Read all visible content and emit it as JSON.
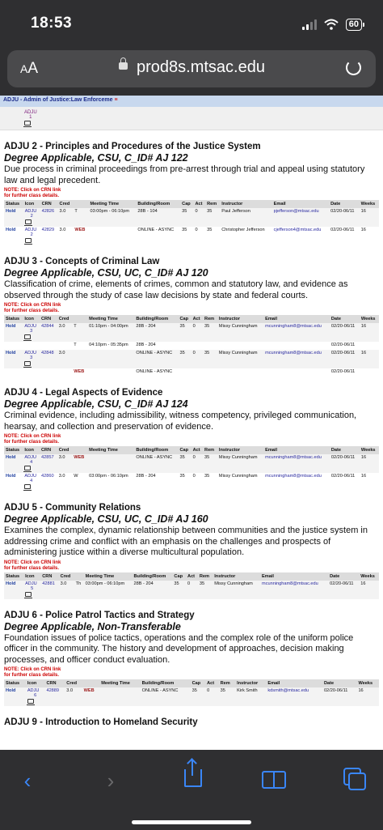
{
  "status": {
    "time": "18:53",
    "battery": "60"
  },
  "browser": {
    "aa_small": "A",
    "aa_big": "A",
    "url": "prod8s.mtsac.edu"
  },
  "subject_bar": {
    "label": "ADJU - Admin of Justice:Law Enforceme",
    "menu_icon": "≡"
  },
  "top_fragment": {
    "icon_code": "ADJU",
    "icon_num": "1"
  },
  "columns": [
    "Status",
    "Icon",
    "CRN",
    "Cred",
    "",
    "Meeting Time",
    "Building/Room",
    "Cap",
    "Act",
    "Rem",
    "Instructor",
    "Email",
    "Date",
    "Weeks"
  ],
  "note": {
    "line1": "NOTE: Click on CRN link",
    "line2": "for further class details."
  },
  "courses": [
    {
      "title": "ADJU 2 - Principles and Procedures of the Justice System",
      "sub": "Degree Applicable, CSU, C_ID# AJ 122",
      "desc": "Due process in criminal proceedings from pre-arrest through trial and appeal using statutory law and legal precedent.",
      "rows": [
        {
          "status": "Hold",
          "code": "ADJU",
          "num": "2",
          "crn": "42826",
          "cred": "3.0",
          "day": "T",
          "time": "03:00pm - 06:10pm",
          "room": "28B - 104",
          "cap": "35",
          "act": "0",
          "rem": "35",
          "instructor": "Paul Jefferson",
          "email": "pjefferson@mtsac.edu",
          "date": "02/20-06/11",
          "weeks": "16"
        },
        {
          "status": "Hold",
          "code": "ADJU",
          "num": "2",
          "crn": "42829",
          "cred": "3.0",
          "day": "WEB",
          "time": "",
          "room": "ONLINE - ASYNC",
          "cap": "35",
          "act": "0",
          "rem": "35",
          "instructor": "Christopher Jefferson",
          "email": "cjefferson4@mtsac.edu",
          "date": "02/20-06/11",
          "weeks": "16"
        }
      ]
    },
    {
      "title": "ADJU 3 - Concepts of Criminal Law",
      "sub": "Degree Applicable, CSU, UC, C_ID# AJ 120",
      "desc": "Classification of crime, elements of crimes, common and statutory law, and evidence as observed through the study of case law decisions by state and federal courts.",
      "rows": [
        {
          "status": "Hold",
          "code": "ADJU",
          "num": "3",
          "crn": "42844",
          "cred": "3.0",
          "day": "T",
          "time": "01:10pm - 04:00pm",
          "room": "28B - 204",
          "cap": "35",
          "act": "0",
          "rem": "35",
          "instructor": "Missy Cunningham",
          "email": "mcunningham8@mtsac.edu",
          "date": "02/20-06/11",
          "weeks": "16"
        },
        {
          "status": "",
          "code": "",
          "num": "",
          "crn": "",
          "cred": "",
          "day": "T",
          "time": "04:10pm - 05:35pm",
          "room": "28B - 204",
          "cap": "",
          "act": "",
          "rem": "",
          "instructor": "",
          "email": "",
          "date": "02/20-06/11",
          "weeks": "",
          "sub": true
        },
        {
          "status": "Hold",
          "code": "ADJU",
          "num": "3",
          "crn": "42848",
          "cred": "3.0",
          "day": "",
          "time": "",
          "room": "ONLINE - ASYNC",
          "cap": "35",
          "act": "0",
          "rem": "35",
          "instructor": "Missy Cunningham",
          "email": "mcunningham8@mtsac.edu",
          "date": "02/20-06/11",
          "weeks": "16"
        },
        {
          "status": "",
          "code": "",
          "num": "",
          "crn": "",
          "cred": "",
          "day": "WEB",
          "time": "",
          "room": "ONLINE - ASYNC",
          "cap": "",
          "act": "",
          "rem": "",
          "instructor": "",
          "email": "",
          "date": "02/20-06/11",
          "weeks": "",
          "sub": true
        }
      ]
    },
    {
      "title": "ADJU 4 - Legal Aspects of Evidence",
      "sub": "Degree Applicable, CSU, C_ID# AJ 124",
      "desc": "Criminal evidence, including admissibility, witness competency, privileged communication, hearsay, and collection and preservation of evidence.",
      "rows": [
        {
          "status": "Hold",
          "code": "ADJU",
          "num": "4",
          "crn": "42857",
          "cred": "3.0",
          "day": "WEB",
          "time": "",
          "room": "ONLINE - ASYNC",
          "cap": "35",
          "act": "0",
          "rem": "35",
          "instructor": "Missy Cunningham",
          "email": "mcunningham8@mtsac.edu",
          "date": "02/20-06/11",
          "weeks": "16"
        },
        {
          "status": "Hold",
          "code": "ADJU",
          "num": "4",
          "crn": "42860",
          "cred": "3.0",
          "day": "W",
          "time": "03:00pm - 06:10pm",
          "room": "28B - 204",
          "cap": "35",
          "act": "0",
          "rem": "35",
          "instructor": "Missy Cunningham",
          "email": "mcunningham8@mtsac.edu",
          "date": "02/20-06/11",
          "weeks": "16"
        }
      ]
    },
    {
      "title": "ADJU 5 - Community Relations",
      "sub": "Degree Applicable, CSU, UC, C_ID# AJ 160",
      "desc": "Examines the complex, dynamic relationship between communities and the justice system in addressing crime and conflict with an emphasis on the challenges and prospects of administering justice within a diverse multicultural population.",
      "rows": [
        {
          "status": "Hold",
          "code": "ADJU",
          "num": "5",
          "crn": "42881",
          "cred": "3.0",
          "day": "Th",
          "time": "03:00pm - 06:10pm",
          "room": "28B - 204",
          "cap": "35",
          "act": "0",
          "rem": "35",
          "instructor": "Missy Cunningham",
          "email": "mcunningham8@mtsac.edu",
          "date": "02/20-06/11",
          "weeks": "16"
        }
      ]
    },
    {
      "title": "ADJU 6 - Police Patrol Tactics and Strategy",
      "sub": "Degree Applicable, Non-Transferable",
      "desc": "Foundation issues of police tactics, operations and the complex role of the uniform police officer in the community. The history and development of approaches, decision making processes, and officer conduct evaluation.",
      "rows": [
        {
          "status": "Hold",
          "code": "ADJU",
          "num": "6",
          "crn": "42889",
          "cred": "3.0",
          "day": "WEB",
          "time": "",
          "room": "ONLINE - ASYNC",
          "cap": "35",
          "act": "0",
          "rem": "35",
          "instructor": "Kirk Smith",
          "email": "kdsmith@mtsac.edu",
          "date": "02/20-06/11",
          "weeks": "16"
        }
      ]
    }
  ],
  "next_course_title": "ADJU 9 - Introduction to Homeland Security",
  "toolbar": {
    "back": "‹",
    "forward": "›"
  }
}
